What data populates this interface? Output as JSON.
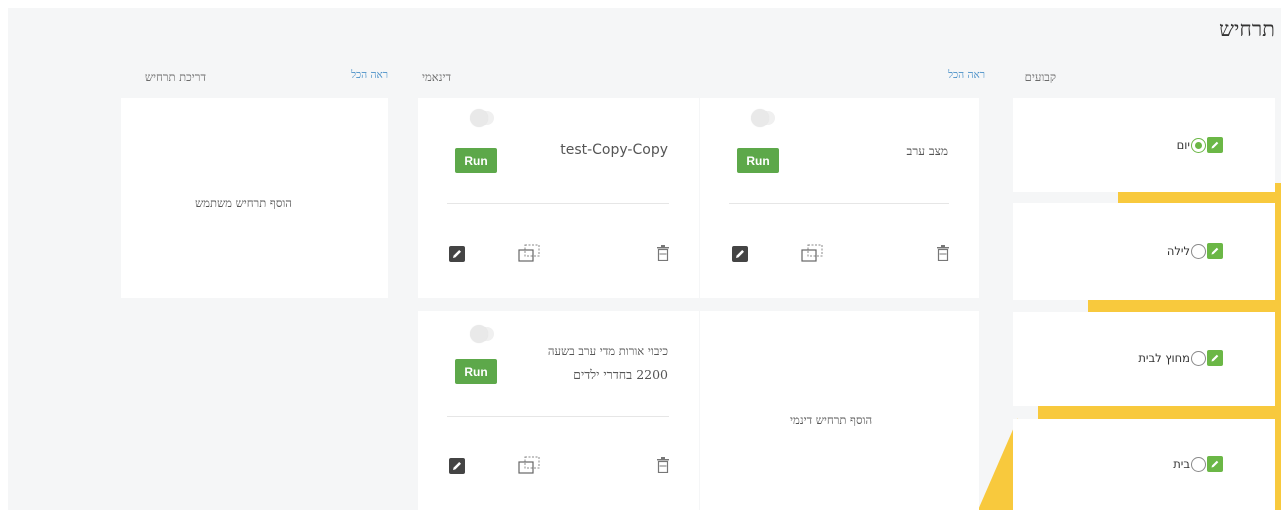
{
  "page_title": "תרחיש",
  "sections": {
    "fixed": {
      "label": "קבועים",
      "see_all": "ראה הכל"
    },
    "dynamic": {
      "label": "דינאמי",
      "see_all": "ראה הכל"
    },
    "rating": {
      "label": "דריכת תרחיש"
    }
  },
  "fixed_scenes": [
    {
      "label": "יום",
      "selected": true
    },
    {
      "label": "לילה",
      "selected": false
    },
    {
      "label": "מחוץ לבית",
      "selected": false
    },
    {
      "label": "בית",
      "selected": false
    }
  ],
  "dynamic_scenes": [
    {
      "name": "מצב ערב",
      "run_label": "Run",
      "enabled": false
    },
    {
      "name": "test-Copy-Copy",
      "run_label": "Run",
      "enabled": false
    },
    {
      "name_line1": "כיבוי אורות מדי ערב בשעה",
      "name_line2": "2200 בחדרי ילדים",
      "run_label": "Run",
      "enabled": false
    }
  ],
  "add_dynamic_label": "הוסף תרחיש דינמי",
  "add_user_label": "הוסף תרחיש משתמש",
  "icons": {
    "edit": "edit-pencil-icon",
    "duplicate": "duplicate-icon",
    "delete": "trash-icon",
    "radio": "radio-icon"
  },
  "colors": {
    "accent_green": "#5da84a",
    "yellow": "#f8c93d",
    "link_blue": "#4a90c8"
  }
}
